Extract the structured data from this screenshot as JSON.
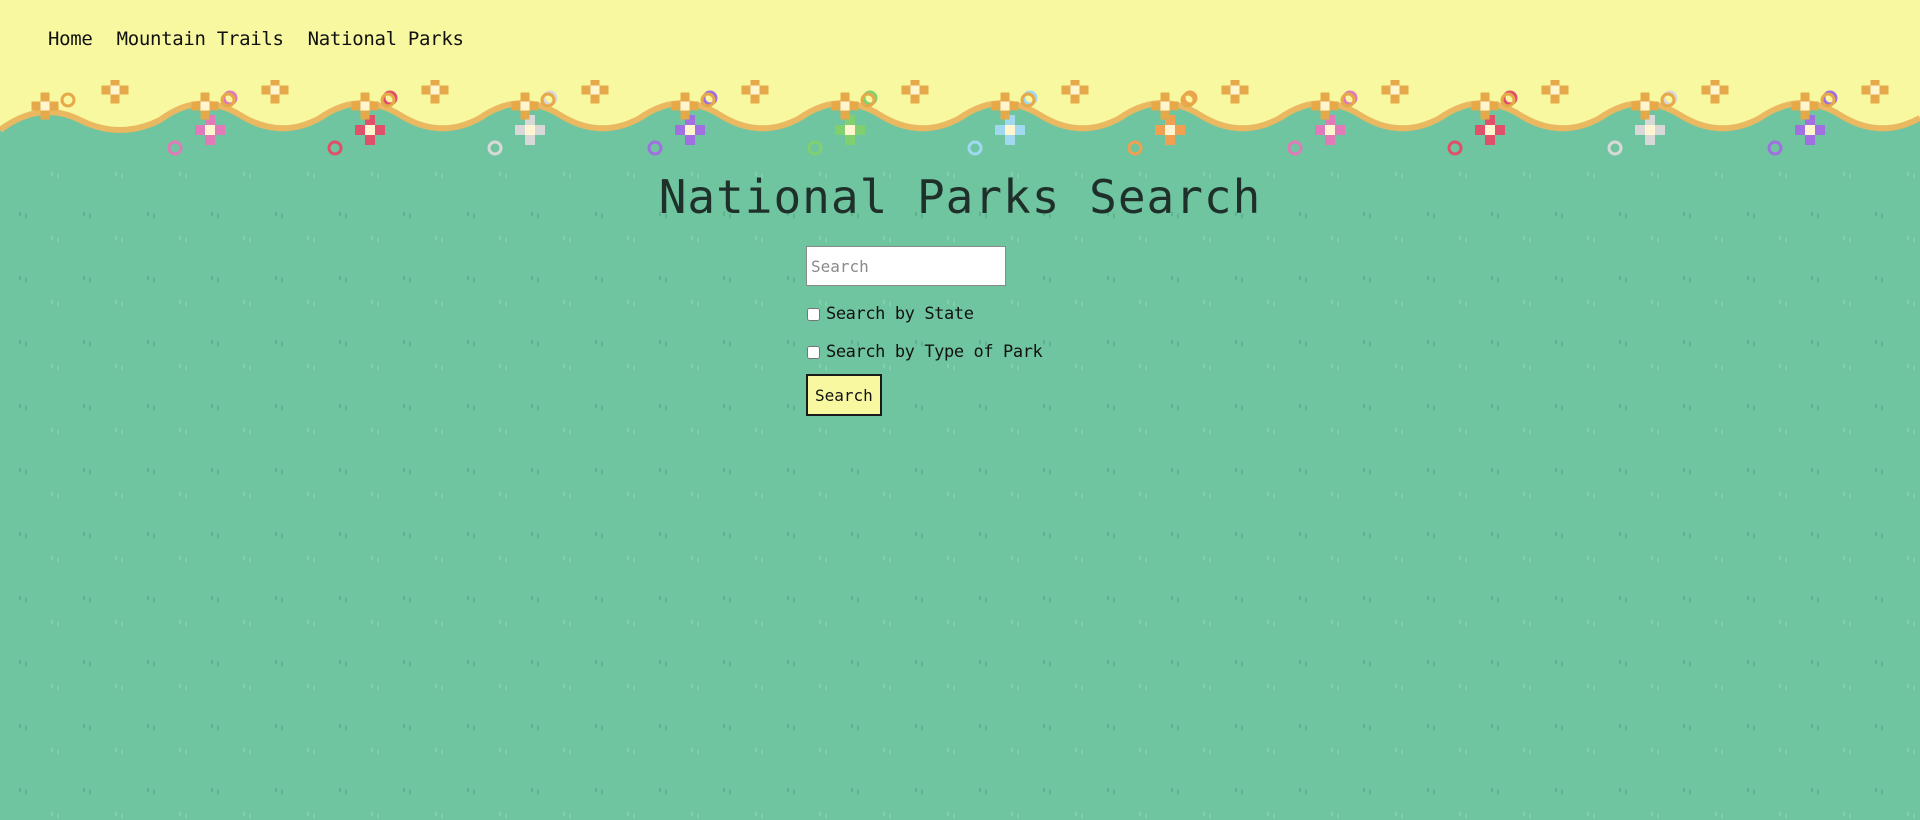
{
  "nav": {
    "items": [
      {
        "label": "Home"
      },
      {
        "label": "Mountain Trails"
      },
      {
        "label": "National Parks"
      }
    ]
  },
  "header": {
    "background_color": "#f8f8a0",
    "flower_colors": [
      "#e6a94a",
      "#e07ab8",
      "#e0506a",
      "#d8d8d8",
      "#a070e0",
      "#80d070",
      "#a0d8f0",
      "#f0a050"
    ]
  },
  "main": {
    "title": "National Parks Search",
    "search": {
      "placeholder": "Search",
      "value": ""
    },
    "filters": [
      {
        "label": "Search by State",
        "checked": false
      },
      {
        "label": "Search by Type of Park",
        "checked": false
      }
    ],
    "submit_label": "Search"
  },
  "theme": {
    "grass_color": "#6fc5a0",
    "button_color": "#f8f8a0"
  }
}
